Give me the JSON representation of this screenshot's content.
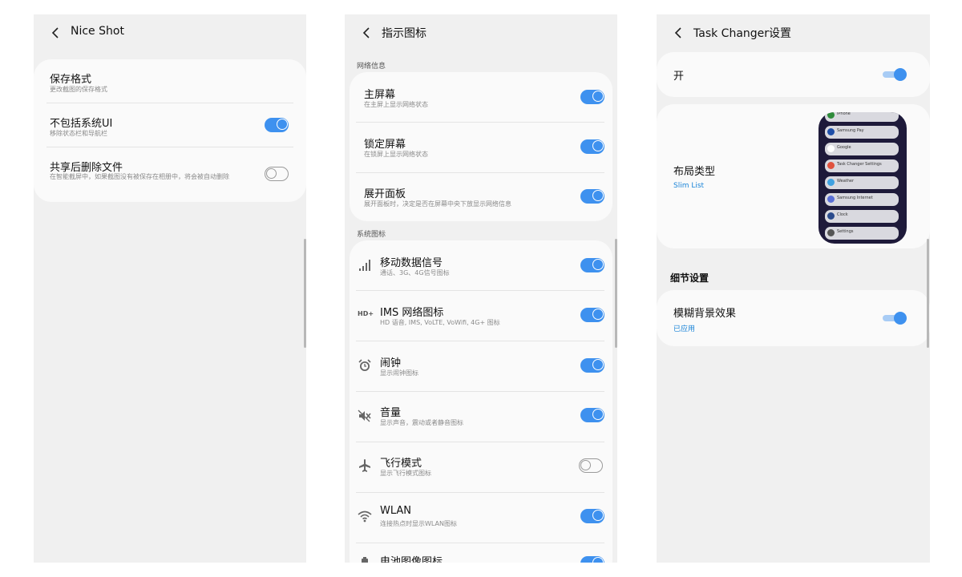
{
  "panel1": {
    "title": "Nice Shot",
    "items": [
      {
        "title": "保存格式",
        "subtitle": "更改截图的保存格式"
      },
      {
        "title": "不包括系统UI",
        "subtitle": "移除状态栏和导航栏",
        "toggle": "on"
      },
      {
        "title": "共享后删除文件",
        "subtitle": "在智能截屏中，如果截图没有被保存在相册中，将会被自动删除",
        "toggle": "off"
      }
    ]
  },
  "panel2": {
    "title": "指示图标",
    "section_network": "网络信息",
    "network_items": [
      {
        "title": "主屏幕",
        "subtitle": "在主屏上显示网络状态",
        "toggle": "on"
      },
      {
        "title": "锁定屏幕",
        "subtitle": "在锁屏上显示网络状态",
        "toggle": "on"
      },
      {
        "title": "展开面板",
        "subtitle": "展开面板时，决定是否在屏幕中央下放显示网络信息",
        "toggle": "on"
      }
    ],
    "section_system": "系统图标",
    "system_items": [
      {
        "icon": "signal-icon",
        "title": "移动数据信号",
        "subtitle": "通话、3G、4G信号图标",
        "toggle": "on"
      },
      {
        "icon": "hd-icon",
        "icon_text": "HD+",
        "title": "IMS 网络图标",
        "subtitle": "HD 语音, IMS, VoLTE, VoWifi, 4G+ 图标",
        "toggle": "on"
      },
      {
        "icon": "alarm-icon",
        "title": "闹钟",
        "subtitle": "显示闹钟图标",
        "toggle": "on"
      },
      {
        "icon": "mute-icon",
        "title": "音量",
        "subtitle": "显示声音，震动或者静音图标",
        "toggle": "on"
      },
      {
        "icon": "airplane-icon",
        "title": "飞行模式",
        "subtitle": "显示飞行模式图标",
        "toggle": "off"
      },
      {
        "icon": "wifi-icon",
        "title": "WLAN",
        "subtitle": "连接热点时显示WLAN图标",
        "toggle": "on"
      },
      {
        "icon": "battery-icon",
        "title": "电池图像图标",
        "subtitle": "",
        "toggle": "on"
      }
    ]
  },
  "panel3": {
    "title": "Task Changer设置",
    "on_label": "开",
    "layout_title": "布局类型",
    "layout_value": "Slim List",
    "preview_apps": [
      {
        "name": "iPhone",
        "color": "#2e8b3a"
      },
      {
        "name": "Samsung Pay",
        "color": "#1f4fa8"
      },
      {
        "name": "Google",
        "color": "#ffffff"
      },
      {
        "name": "Task Changer Settings",
        "color": "#e0533f"
      },
      {
        "name": "Weather",
        "color": "#3fa1e0"
      },
      {
        "name": "Samsung Internet",
        "color": "#5a6fd6"
      },
      {
        "name": "Clock",
        "color": "#2b4b8c"
      },
      {
        "name": "Settings",
        "color": "#555555"
      }
    ],
    "section_detail": "细节设置",
    "blur_title": "模糊背景效果",
    "blur_value": "已应用"
  }
}
